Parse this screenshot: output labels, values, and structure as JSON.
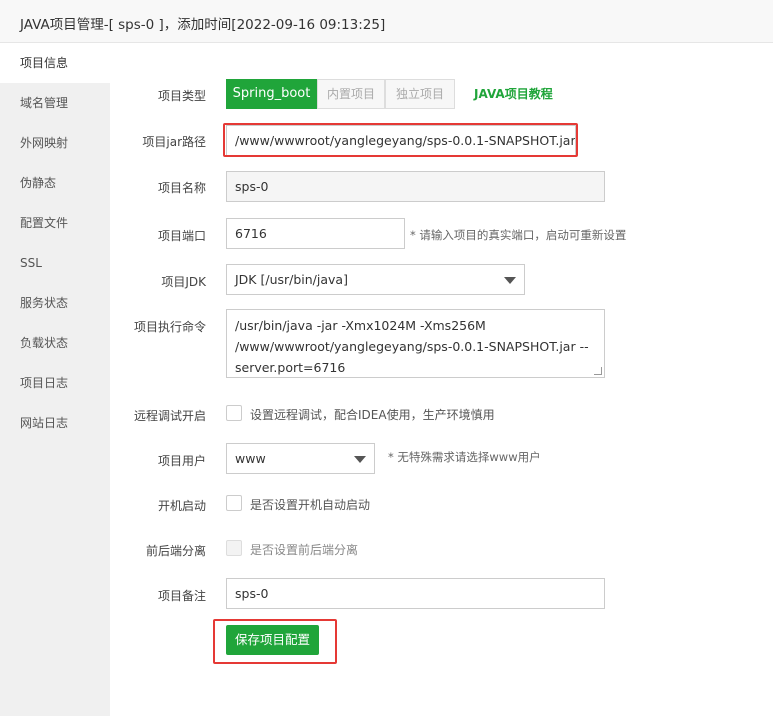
{
  "window": {
    "title": "JAVA项目管理-[ sps-0 ]，添加时间[2022-09-16 09:13:25]"
  },
  "sidebar": {
    "items": [
      {
        "label": "项目信息"
      },
      {
        "label": "域名管理"
      },
      {
        "label": "外网映射"
      },
      {
        "label": "伪静态"
      },
      {
        "label": "配置文件"
      },
      {
        "label": "SSL"
      },
      {
        "label": "服务状态"
      },
      {
        "label": "负载状态"
      },
      {
        "label": "项目日志"
      },
      {
        "label": "网站日志"
      }
    ]
  },
  "form": {
    "project_type": {
      "label": "项目类型",
      "options": [
        "Spring_boot",
        "内置项目",
        "独立项目"
      ],
      "tutorial_link": "JAVA项目教程"
    },
    "jar_path": {
      "label": "项目jar路径",
      "value": "/www/wwwroot/yanglegeyang/sps-0.0.1-SNAPSHOT.jar"
    },
    "name": {
      "label": "项目名称",
      "value": "sps-0"
    },
    "port": {
      "label": "项目端口",
      "value": "6716",
      "tip": "* 请输入项目的真实端口，启动可重新设置"
    },
    "jdk": {
      "label": "项目JDK",
      "value": "JDK [/usr/bin/java]"
    },
    "command": {
      "label": "项目执行命令",
      "lines": [
        "/usr/bin/java -jar -Xmx1024M -Xms256M",
        "/www/wwwroot/yanglegeyang/sps-0.0.1-SNAPSHOT.jar --",
        "server.port=6716"
      ]
    },
    "remote_debug": {
      "label": "远程调试开启",
      "text": "设置远程调试，配合IDEA使用，生产环境慎用"
    },
    "user": {
      "label": "项目用户",
      "value": "www",
      "tip": "* 无特殊需求请选择www用户"
    },
    "autostart": {
      "label": "开机启动",
      "text": "是否设置开机自动启动"
    },
    "separation": {
      "label": "前后端分离",
      "text": "是否设置前后端分离"
    },
    "remark": {
      "label": "项目备注",
      "value": "sps-0"
    },
    "save_label": "保存项目配置"
  },
  "colors": {
    "accent": "#20a53a",
    "highlight": "#e53935"
  }
}
